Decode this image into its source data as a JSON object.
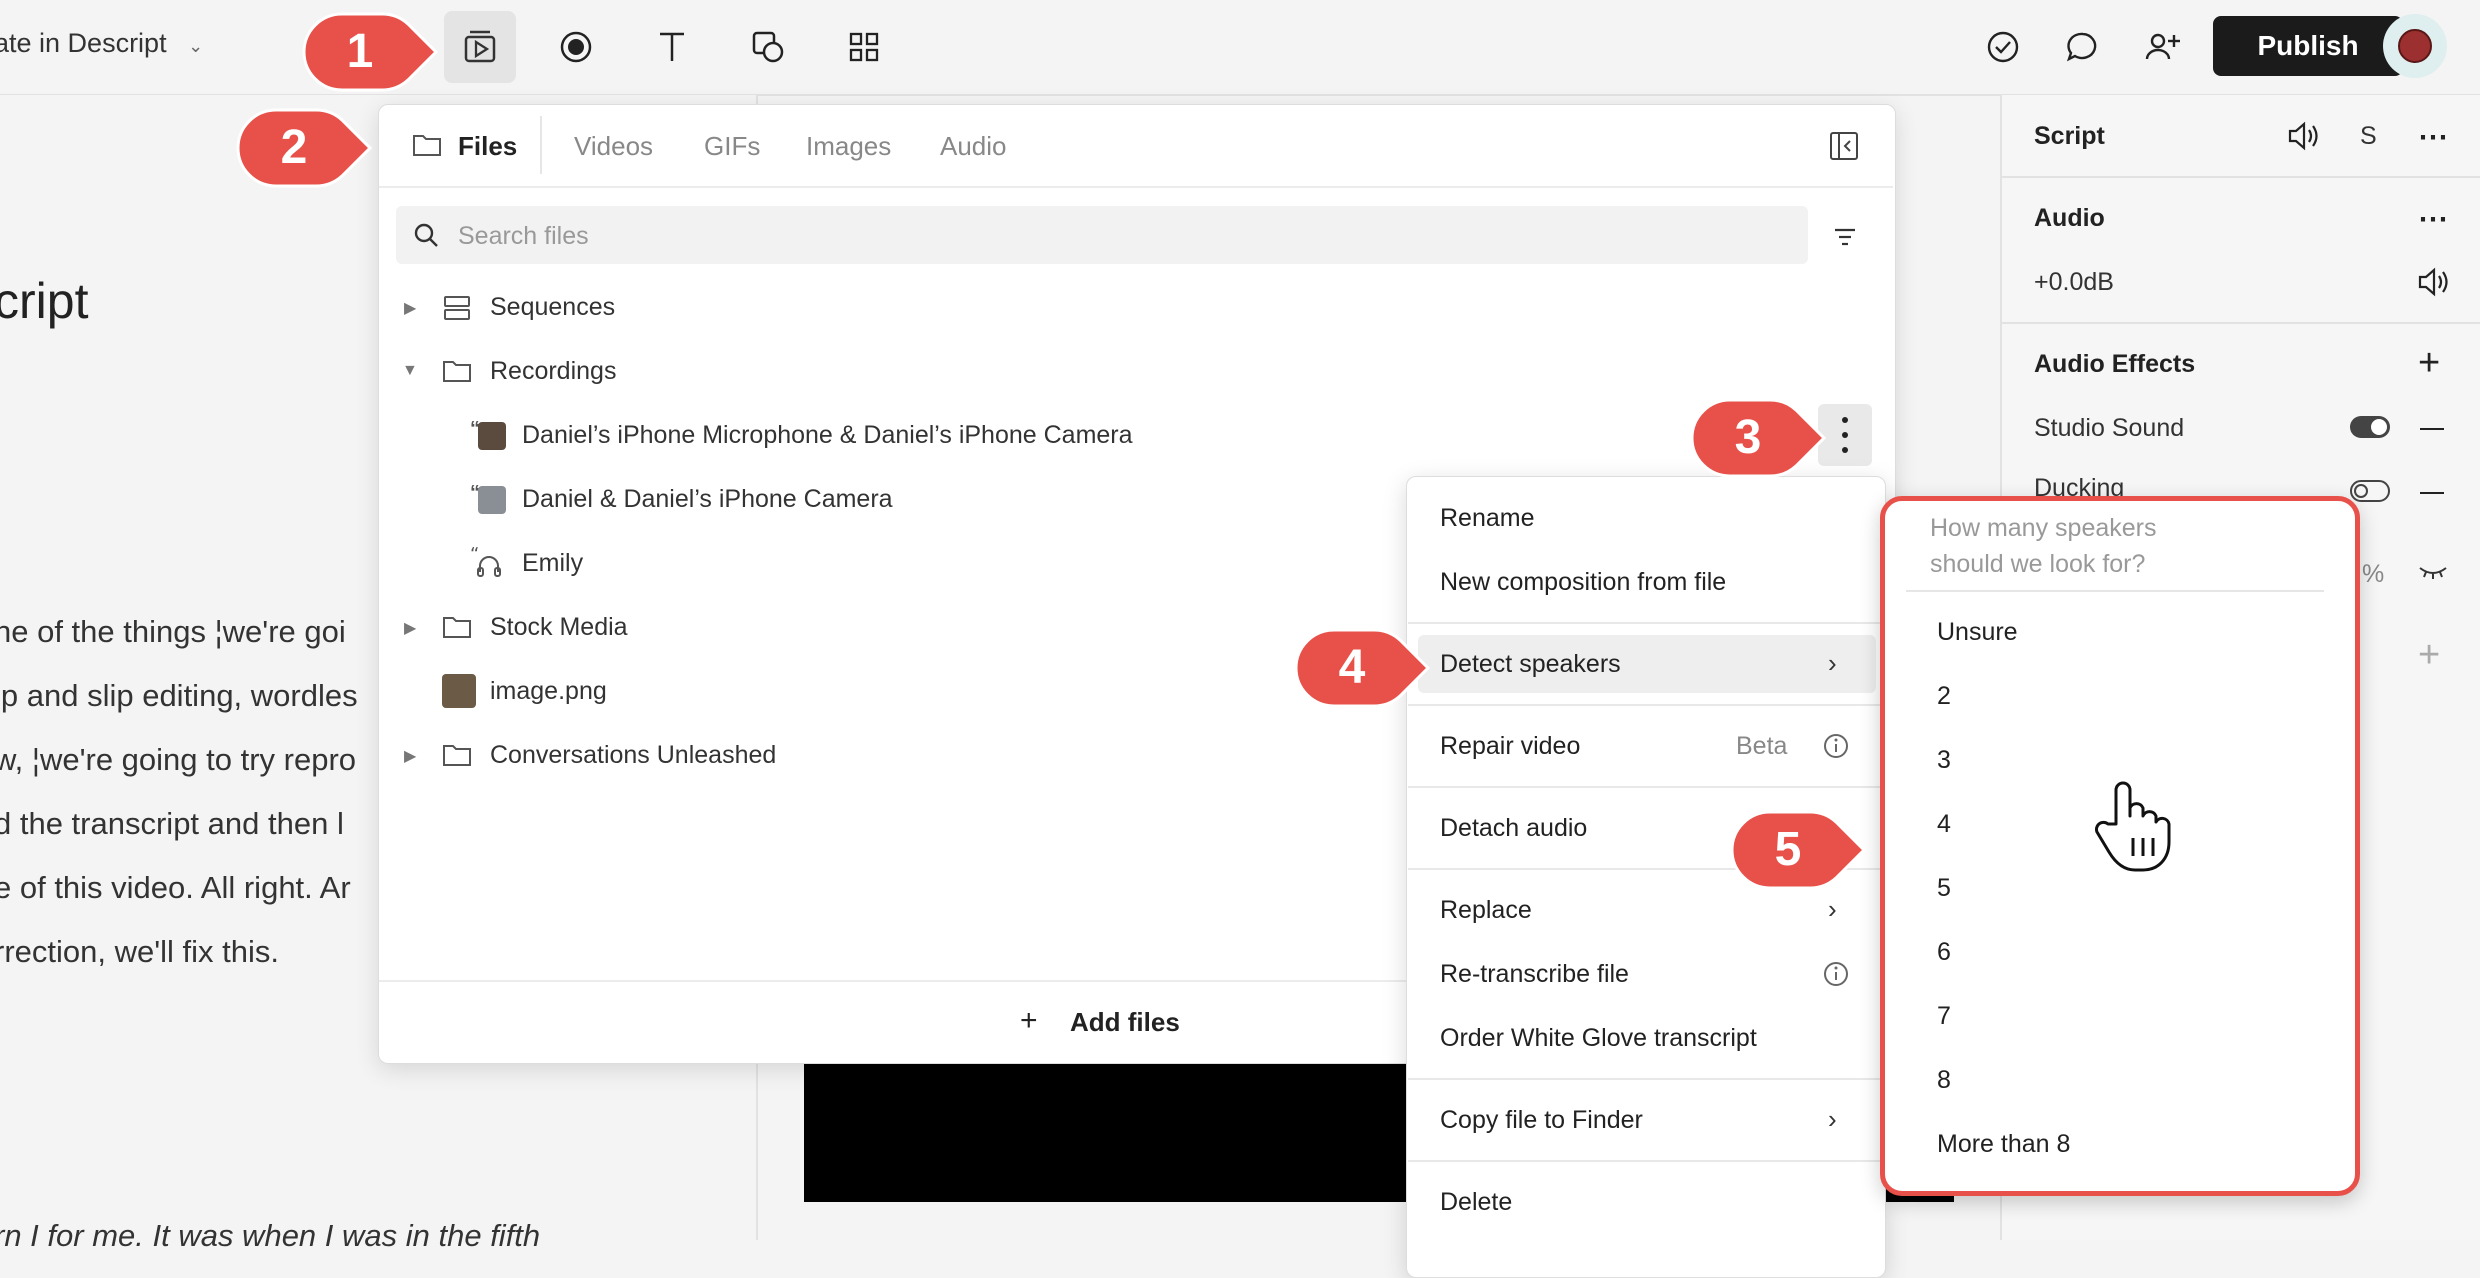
{
  "header": {
    "project_title": "ate in Descript",
    "publish_label": "Publish"
  },
  "toolbar": {
    "icons": [
      "media-library-icon",
      "record-icon",
      "text-icon",
      "shapes-icon",
      "grid-icon"
    ],
    "right_icons": [
      "check-circle-icon",
      "comment-icon",
      "add-user-icon"
    ]
  },
  "script": {
    "title": "cript",
    "lines": [
      "ne of the things ¦we're goi",
      "ip and slip editing, wordles",
      "w, ¦we're going to try repro",
      "d the transcript and then l",
      "e of this video. All right. Ar",
      "rrection, we'll fix this."
    ],
    "bottom_line": "rn I for me. It was when I was in the fifth"
  },
  "media_panel": {
    "tabs": [
      "Files",
      "Videos",
      "GIFs",
      "Images",
      "Audio"
    ],
    "search_placeholder": "Search files",
    "tree": {
      "sequences": "Sequences",
      "recordings": "Recordings",
      "rec1": "Daniel’s iPhone Microphone & Daniel’s iPhone Camera",
      "rec2": "Daniel & Daniel’s iPhone Camera",
      "rec3": "Emily",
      "stock": "Stock Media",
      "image": "image.png",
      "conversations": "Conversations Unleashed"
    },
    "add_files": "Add files"
  },
  "context_menu": {
    "rename": "Rename",
    "new_composition": "New composition from file",
    "detect_speakers": "Detect speakers",
    "repair_video": "Repair video",
    "beta": "Beta",
    "detach_audio": "Detach audio",
    "replace": "Replace",
    "retranscribe": "Re-transcribe file",
    "white_glove": "Order White Glove transcript",
    "copy_to_finder": "Copy file to Finder",
    "delete": "Delete"
  },
  "speakers_menu": {
    "prompt_line1": "How many speakers",
    "prompt_line2": "should we look for?",
    "options": [
      "Unsure",
      "2",
      "3",
      "4",
      "5",
      "6",
      "7",
      "8",
      "More than 8"
    ]
  },
  "right_panel": {
    "script_label": "Script",
    "script_s": "S",
    "audio_label": "Audio",
    "gain": "+0.0dB",
    "effects_label": "Audio Effects",
    "studio_sound": "Studio Sound",
    "ducking": "Ducking",
    "percent": "%"
  },
  "callouts": [
    "1",
    "2",
    "3",
    "4",
    "5"
  ],
  "colors": {
    "callout": "#e8514a",
    "highlight_border": "#e8514a",
    "publish_bg": "#1b1b1b"
  }
}
